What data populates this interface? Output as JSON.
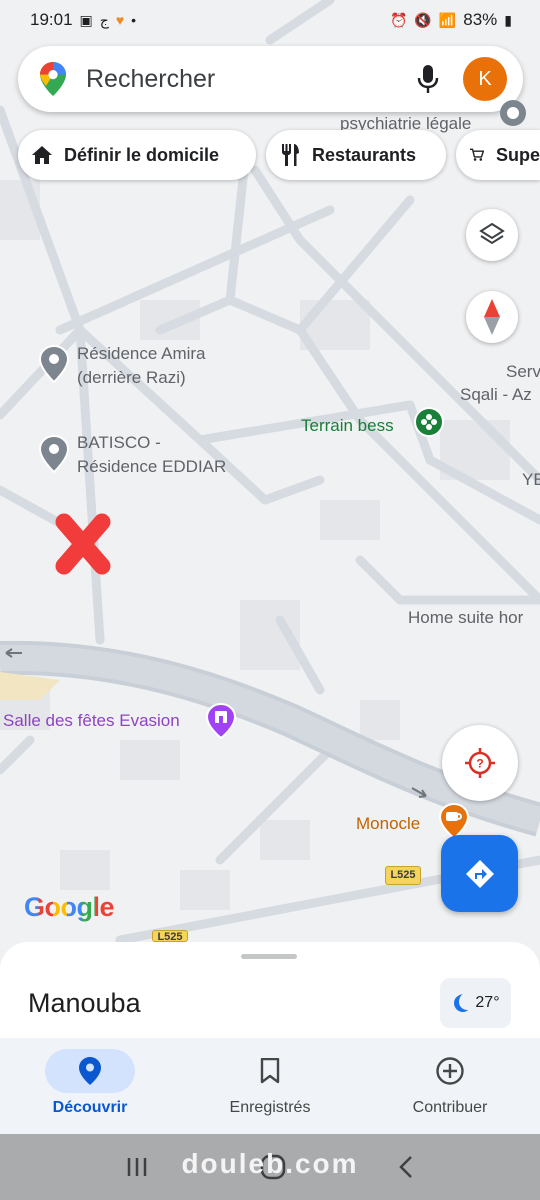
{
  "status_bar": {
    "time": "19:01",
    "battery": "83%"
  },
  "search": {
    "placeholder": "Rechercher",
    "avatar_letter": "K"
  },
  "chips": [
    {
      "label": "Définir le domicile",
      "icon": "home-icon"
    },
    {
      "label": "Restaurants",
      "icon": "restaurant-icon"
    },
    {
      "label": "Supe",
      "icon": "cart-icon"
    }
  ],
  "map_labels": {
    "psychiatrie": "psychiatrie légale",
    "residence_amira_1": "Résidence Amira",
    "residence_amira_2": "(derrière Razi)",
    "batisco_1": "BATISCO -",
    "batisco_2": "Résidence EDDIAR",
    "terrain": "Terrain bess",
    "serv": "Serv",
    "sqali": "Sqali - Az",
    "ye": "YE",
    "home_suite": "Home suite hor",
    "salle": "Salle des fêtes Evasion",
    "monocle": "Monocle",
    "road_1": "L525",
    "road_2": "L525",
    "google": "Google"
  },
  "colors": {
    "terrain": "#188038",
    "salle": "#8e44c2",
    "monocle": "#c26401",
    "road_badge": "#f6d35c",
    "accent": "#1a73e8",
    "marker": "#f23c3c"
  },
  "bottom_sheet": {
    "place": "Manouba",
    "temperature": "27°"
  },
  "bottom_nav": [
    {
      "label": "Découvrir",
      "icon": "location-pin-icon",
      "active": true
    },
    {
      "label": "Enregistrés",
      "icon": "bookmark-icon",
      "active": false
    },
    {
      "label": "Contribuer",
      "icon": "add-circle-icon",
      "active": false
    }
  ],
  "watermark": "douleb.com"
}
